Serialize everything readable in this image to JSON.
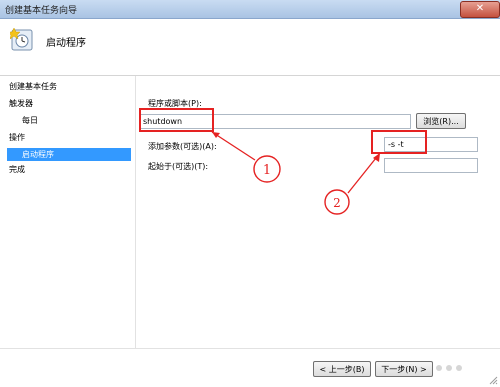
{
  "window": {
    "title": "创建基本任务向导",
    "close_label": "✕"
  },
  "header": {
    "title": "启动程序",
    "icon": "task-clock-icon"
  },
  "sidebar": {
    "items": [
      {
        "label": "创建基本任务",
        "level": 0
      },
      {
        "label": "触发器",
        "level": 0
      },
      {
        "label": "每日",
        "level": 1
      },
      {
        "label": "操作",
        "level": 0
      },
      {
        "label": "启动程序",
        "level": 1,
        "selected": true
      },
      {
        "label": "完成",
        "level": 0
      }
    ]
  },
  "form": {
    "program_label": "程序或脚本(P):",
    "program_value": "shutdown",
    "browse_label": "浏览(R)...",
    "args_label": "添加参数(可选)(A):",
    "args_value": "-s -t",
    "startin_label": "起始于(可选)(T):",
    "startin_value": ""
  },
  "annotations": {
    "marker_1": "1",
    "marker_2": "2",
    "color": "#e52222"
  },
  "footer": {
    "back_label": "< 上一步(B)",
    "next_label": "下一步(N) >"
  }
}
